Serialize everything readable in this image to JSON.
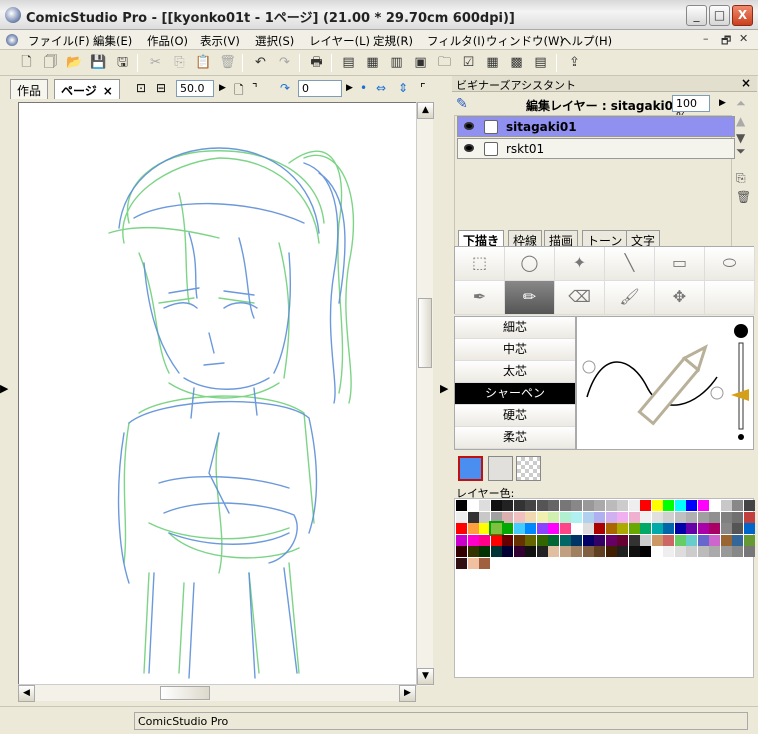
{
  "window": {
    "title": "ComicStudio Pro - [[kyonko01t - 1ページ] (21.00 * 29.70cm 600dpi)]",
    "minimize": "_",
    "maximize": "□",
    "close": "X"
  },
  "menubar": {
    "items": [
      "ファイル(F)",
      "編集(E)",
      "作品(O)",
      "表示(V)",
      "選択(S)",
      "レイヤー(L)",
      "定規(R)",
      "フィルタ(I)",
      "ウィンドウ(W)",
      "ヘルプ(H)"
    ],
    "mdi": [
      "–",
      "🗗",
      "✕"
    ]
  },
  "toolbar": {
    "icons": [
      "new-page-icon",
      "new-work-icon",
      "open-icon",
      "save-icon",
      "save-all-icon",
      "cut-icon",
      "copy-icon",
      "paste-icon",
      "delete-icon",
      "undo-icon",
      "redo-icon",
      "print-icon",
      "page-manage-icon",
      "layer-icon",
      "story-icon",
      "window-icon",
      "folder-icon",
      "check-icon",
      "grid-icon",
      "palette-icon",
      "export-icon"
    ]
  },
  "page_pane": {
    "tabs": [
      "作品",
      "ページ"
    ],
    "tab_close": "×",
    "zoom_value": "50.0",
    "rotate_value": "0"
  },
  "beginner_panel": {
    "title": "ビギナーズアシスタント",
    "close": "×",
    "edit_layer_label": "編集レイヤー : sitagaki01",
    "opacity": "100 %",
    "layers": [
      {
        "name": "sitagaki01",
        "selected": true
      },
      {
        "name": "rskt01",
        "selected": false
      }
    ],
    "tool_tabs": [
      "下描き",
      "枠線",
      "描画",
      "トーン",
      "文字"
    ],
    "sub_tools": [
      "細芯",
      "中芯",
      "太芯",
      "シャーペン",
      "硬芯",
      "柔芯"
    ],
    "selected_sub_tool": "シャーペン",
    "layer_color_label": "レイヤー色:",
    "main_color": "#4a8ef0"
  },
  "status": {
    "text": "ComicStudio Pro"
  }
}
